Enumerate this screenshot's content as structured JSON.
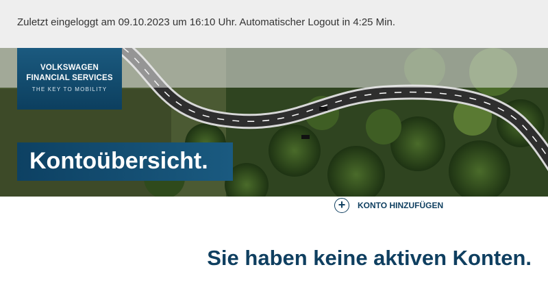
{
  "session": {
    "last_login_text": "Zuletzt eingeloggt am 09.10.2023 um 16:10 Uhr. Automatischer Logout in 4:25 Min."
  },
  "logo": {
    "line1": "VOLKSWAGEN",
    "line2": "FINANCIAL SERVICES",
    "tagline": "THE KEY TO MOBILITY"
  },
  "hero": {
    "page_title": "Kontoübersicht."
  },
  "actions": {
    "add_account_icon": "plus-circle-icon",
    "add_account_label": "KONTO HINZUFÜGEN"
  },
  "main": {
    "empty_message": "Sie haben keine aktiven Konten."
  },
  "colors": {
    "brand_dark_blue": "#0f3f60",
    "brand_blue": "#1b5a7f",
    "topbar_bg": "#eeeeee"
  }
}
